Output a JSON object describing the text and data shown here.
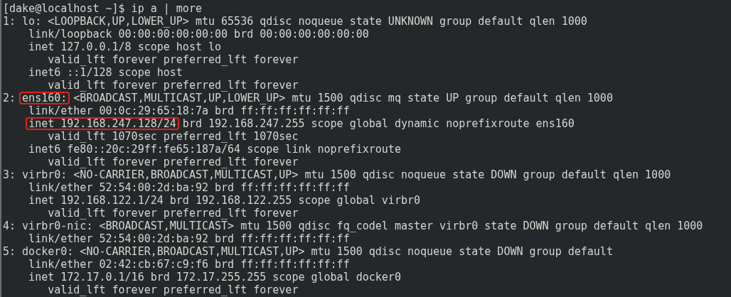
{
  "terminal": {
    "lines": [
      {
        "segments": [
          {
            "text": "[dake@localhost ~]$ ip a | more",
            "boxed": false
          }
        ]
      },
      {
        "segments": [
          {
            "text": "1: lo: <LOOPBACK,UP,LOWER_UP> mtu 65536 qdisc noqueue state UNKNOWN group default qlen 1000",
            "boxed": false
          }
        ]
      },
      {
        "segments": [
          {
            "text": "    link/loopback 00:00:00:00:00:00 brd 00:00:00:00:00:00",
            "boxed": false
          }
        ]
      },
      {
        "segments": [
          {
            "text": "    inet 127.0.0.1/8 scope host lo",
            "boxed": false
          }
        ]
      },
      {
        "segments": [
          {
            "text": "       valid_lft forever preferred_lft forever",
            "boxed": false
          }
        ]
      },
      {
        "segments": [
          {
            "text": "    inet6 ::1/128 scope host",
            "boxed": false
          }
        ]
      },
      {
        "segments": [
          {
            "text": "       valid_lft forever preferred_lft forever",
            "boxed": false
          }
        ]
      },
      {
        "segments": [
          {
            "text": "2: ",
            "boxed": false
          },
          {
            "text": "ens160:",
            "boxed": true
          },
          {
            "text": " <BROADCAST,MULTICAST,UP,LOWER_UP> mtu 1500 qdisc mq state UP group default qlen 1000",
            "boxed": false
          }
        ]
      },
      {
        "segments": [
          {
            "text": "    link/ether 00:0c:29:65:18:7a brd ff:ff:ff:ff:ff:ff",
            "boxed": false
          }
        ]
      },
      {
        "segments": [
          {
            "text": "    inet 192.168.247.128/24",
            "boxed": true
          },
          {
            "text": " brd 192.168.247.255 scope global dynamic noprefixroute ens160",
            "boxed": false
          }
        ]
      },
      {
        "segments": [
          {
            "text": "       valid_lft 1070sec preferred_lft 1070sec",
            "boxed": false
          }
        ]
      },
      {
        "segments": [
          {
            "text": "    inet6 fe80::20c:29ff:fe65:187a/64 scope link noprefixroute",
            "boxed": false
          }
        ]
      },
      {
        "segments": [
          {
            "text": "       valid_lft forever preferred_lft forever",
            "boxed": false
          }
        ]
      },
      {
        "segments": [
          {
            "text": "3: virbr0: <NO-CARRIER,BROADCAST,MULTICAST,UP> mtu 1500 qdisc noqueue state DOWN group default qlen 1000",
            "boxed": false
          }
        ]
      },
      {
        "segments": [
          {
            "text": "    link/ether 52:54:00:2d:ba:92 brd ff:ff:ff:ff:ff:ff",
            "boxed": false
          }
        ]
      },
      {
        "segments": [
          {
            "text": "    inet 192.168.122.1/24 brd 192.168.122.255 scope global virbr0",
            "boxed": false
          }
        ]
      },
      {
        "segments": [
          {
            "text": "       valid_lft forever preferred_lft forever",
            "boxed": false
          }
        ]
      },
      {
        "segments": [
          {
            "text": "4: virbr0-nic: <BROADCAST,MULTICAST> mtu 1500 qdisc fq_codel master virbr0 state DOWN group default qlen 1000",
            "boxed": false
          }
        ]
      },
      {
        "segments": [
          {
            "text": "    link/ether 52:54:00:2d:ba:92 brd ff:ff:ff:ff:ff:ff",
            "boxed": false
          }
        ]
      },
      {
        "segments": [
          {
            "text": "5: docker0: <NO-CARRIER,BROADCAST,MULTICAST,UP> mtu 1500 qdisc noqueue state DOWN group default",
            "boxed": false
          }
        ]
      },
      {
        "segments": [
          {
            "text": "    link/ether 02:42:cb:67:c9:f6 brd ff:ff:ff:ff:ff:ff",
            "boxed": false
          }
        ]
      },
      {
        "segments": [
          {
            "text": "    inet 172.17.0.1/16 brd 172.17.255.255 scope global docker0",
            "boxed": false
          }
        ]
      },
      {
        "segments": [
          {
            "text": "       valid_lft forever preferred_lft forever",
            "boxed": false
          }
        ]
      }
    ]
  }
}
